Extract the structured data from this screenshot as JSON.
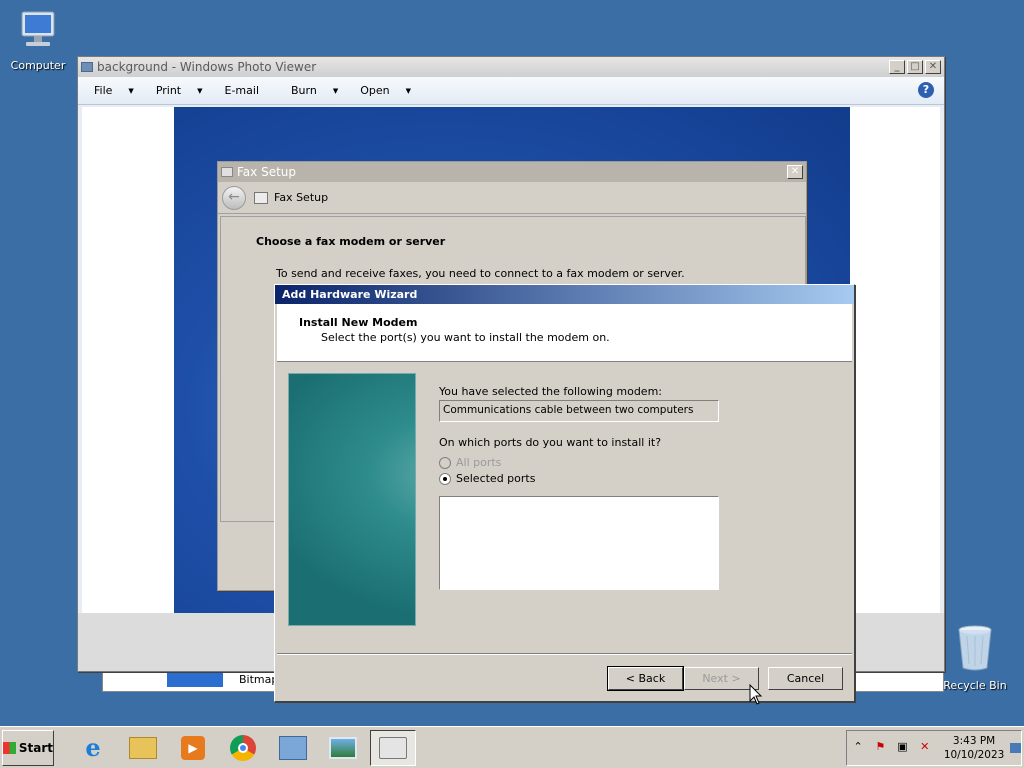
{
  "desktop": {
    "icons": [
      {
        "label": "Computer",
        "icon": "computer-icon"
      },
      {
        "label": "Recycle Bin",
        "icon": "recycle-bin-icon"
      }
    ],
    "background_color": "#3a6ea5"
  },
  "photo_viewer": {
    "title": "background - Windows Photo Viewer",
    "menu": [
      "File",
      "Print",
      "E-mail",
      "Burn",
      "Open"
    ],
    "behind_label": "Bitmap"
  },
  "fax_setup": {
    "title": "Fax Setup",
    "nav_title": "Fax Setup",
    "heading": "Choose a fax modem or server",
    "description": "To send and receive faxes, you need to connect to a fax modem or server."
  },
  "wizard": {
    "title": "Add Hardware Wizard",
    "header_title": "Install New Modem",
    "header_subtitle": "Select the port(s) you want to install the modem on.",
    "selected_label": "You have selected the following modem:",
    "selected_modem": "Communications cable between two computers",
    "ports_question": "On which ports do you want to install it?",
    "radio_all": "All ports",
    "radio_selected": "Selected ports",
    "back_label": "< Back",
    "next_label": "Next >",
    "cancel_label": "Cancel"
  },
  "taskbar": {
    "start_label": "Start",
    "time": "3:43 PM",
    "date": "10/10/2023"
  }
}
